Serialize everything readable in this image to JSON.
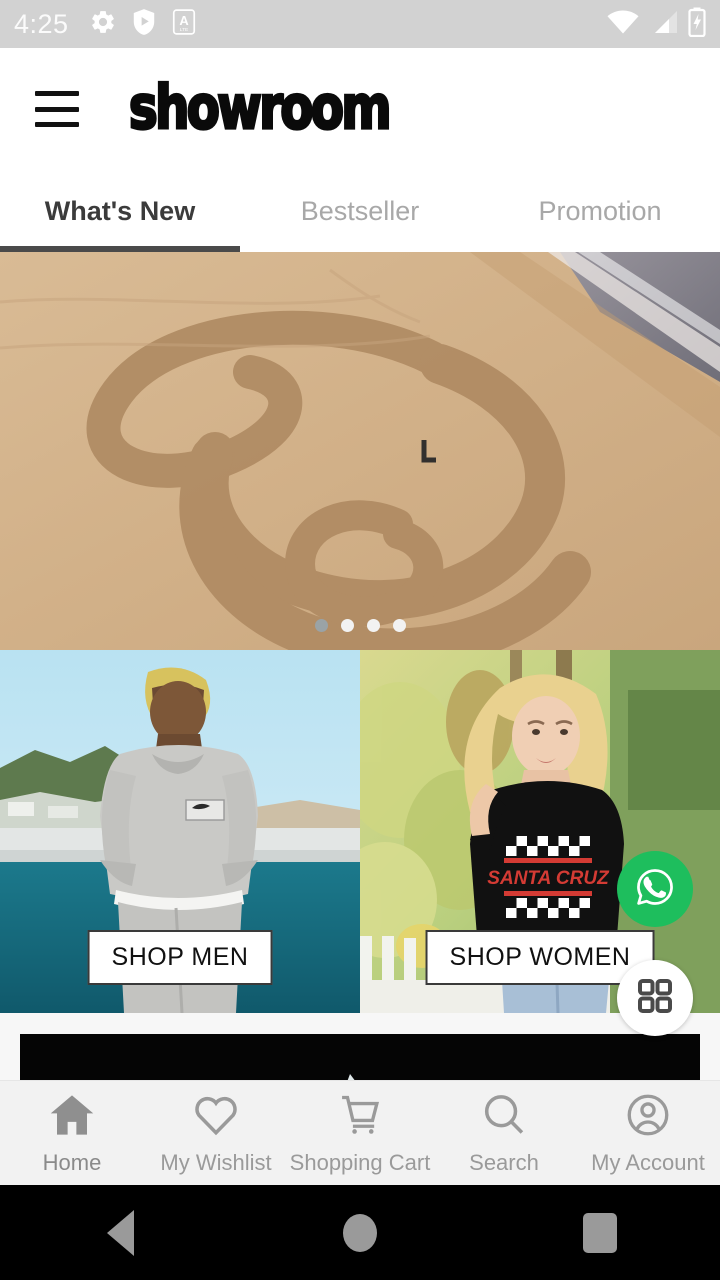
{
  "statusbar": {
    "time": "4:25",
    "left_icons": [
      "gear-icon",
      "play-protect-shield-icon",
      "a-badge-icon"
    ],
    "right_icons": [
      "wifi-icon",
      "cellular-signal-icon",
      "battery-charging-icon"
    ]
  },
  "header": {
    "menu_icon": "hamburger-menu-icon",
    "logo_text": "showroom"
  },
  "tabs": {
    "items": [
      {
        "label": "What's New",
        "active": true
      },
      {
        "label": "Bestseller",
        "active": false
      },
      {
        "label": "Promotion",
        "active": false
      }
    ]
  },
  "hero": {
    "alt": "Aerial photo of a large spiral drawn in beach sand beside the ocean",
    "dots": {
      "count": 4,
      "active_index": 0
    }
  },
  "cards": [
    {
      "alt": "Man in grey sweatshirt and sweatpants standing by the ocean",
      "button_label": "SHOP MEN"
    },
    {
      "alt": "Woman in black Santa Cruz checkered tee standing outdoors",
      "button_label": "SHOP WOMEN"
    }
  ],
  "floating_buttons": [
    {
      "name": "whatsapp-fab",
      "icon": "whatsapp-icon",
      "color": "#1ebe5d"
    },
    {
      "name": "grid-menu-fab",
      "icon": "grid-2x2-icon",
      "color": "#ffffff"
    }
  ],
  "partial_banner": {
    "alt": "Partially visible dark promotional banner below the category cards"
  },
  "bottomnav": {
    "items": [
      {
        "label": "Home",
        "icon": "home-icon",
        "active": true
      },
      {
        "label": "My Wishlist",
        "icon": "heart-icon",
        "active": false
      },
      {
        "label": "Shopping Cart",
        "icon": "shopping-cart-icon",
        "active": false
      },
      {
        "label": "Search",
        "icon": "search-icon",
        "active": false
      },
      {
        "label": "My Account",
        "icon": "user-account-icon",
        "active": false
      }
    ]
  },
  "androidnav": {
    "items": [
      {
        "name": "back-button",
        "icon": "triangle-back-icon"
      },
      {
        "name": "home-button",
        "icon": "circle-home-icon"
      },
      {
        "name": "recents-button",
        "icon": "square-recents-icon"
      }
    ]
  },
  "colors": {
    "statusbar_bg": "#d2d2d2",
    "accent_active_tab": "#4a4a4a",
    "whatsapp_green": "#1ebe5d",
    "bottomnav_bg": "#f2f2f2"
  }
}
